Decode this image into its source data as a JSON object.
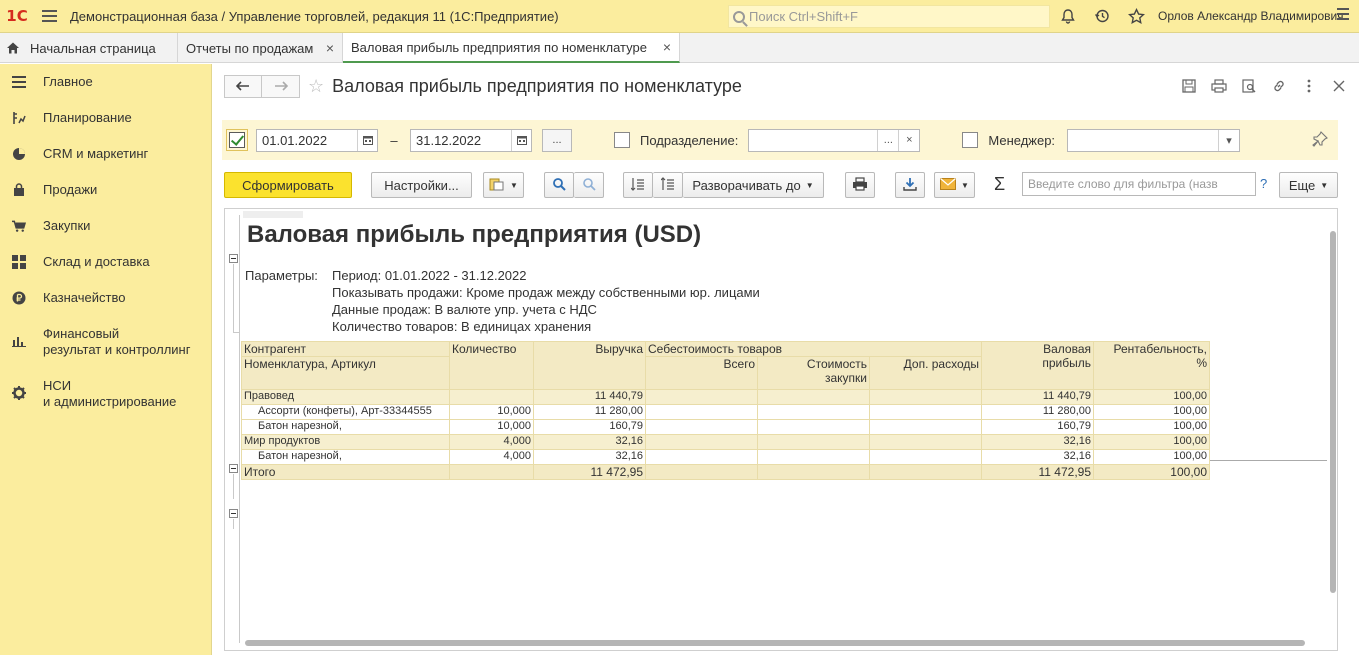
{
  "topbar": {
    "logo": "1С",
    "app_title": "Демонстрационная база / Управление торговлей, редакция 11  (1С:Предприятие)",
    "search_placeholder": "Поиск Ctrl+Shift+F",
    "user_name": "Орлов Александр Владимирович",
    "icons": [
      "bell-icon",
      "history-icon",
      "star-icon"
    ]
  },
  "tabs": [
    {
      "label": "Начальная страница"
    },
    {
      "label": "Отчеты по продажам"
    },
    {
      "label": "Валовая прибыль предприятия по номенклатуре"
    }
  ],
  "sidebar": {
    "items": [
      {
        "label": "Главное",
        "icon": "menu-list-icon"
      },
      {
        "label": "Планирование",
        "icon": "planning-icon"
      },
      {
        "label": "CRM и маркетинг",
        "icon": "pie-chart-icon"
      },
      {
        "label": "Продажи",
        "icon": "shopping-bag-icon"
      },
      {
        "label": "Закупки",
        "icon": "cart-icon"
      },
      {
        "label": "Склад и доставка",
        "icon": "warehouse-icon"
      },
      {
        "label": "Казначейство",
        "icon": "ruble-coin-icon"
      },
      {
        "label_line1": "Финансовый",
        "label_line2": "результат и контроллинг",
        "icon": "bar-chart-icon"
      },
      {
        "label_line1": "НСИ",
        "label_line2": "и администрирование",
        "icon": "gear-icon"
      }
    ]
  },
  "page": {
    "title": "Валовая прибыль предприятия по номенклатуре"
  },
  "params": {
    "period_enabled": true,
    "date_from": "01.01.2022",
    "date_sep": "–",
    "date_to": "31.12.2022",
    "dots": "...",
    "division_label": "Подразделение:",
    "manager_label": "Менеджер:"
  },
  "toolbar": {
    "generate": "Сформировать",
    "settings": "Настройки...",
    "expand_to": "Разворачивать до",
    "filter_placeholder": "Введите слово для фильтра (назв",
    "help": "?",
    "more": "Еще"
  },
  "report": {
    "title": "Валовая прибыль предприятия (USD)",
    "params_label": "Параметры:",
    "params_lines": [
      "Период: 01.01.2022 - 31.12.2022",
      "Показывать продажи: Кроме продаж между собственными юр. лицами",
      "Данные продаж: В валюте упр. учета с НДС",
      "Количество товаров: В единицах хранения"
    ],
    "headers": {
      "counterparty": "Контрагент",
      "item": "Номенклатура, Артикул",
      "qty": "Количество",
      "revenue": "Выручка",
      "cost_group": "Себестоимость товаров",
      "cost_total": "Всего",
      "purchase_cost_1": "Стоимость",
      "purchase_cost_2": "закупки",
      "extra_costs": "Доп. расходы",
      "gross_1": "Валовая",
      "gross_2": "прибыль",
      "margin_1": "Рентабельность,",
      "margin_2": "%"
    },
    "rows": [
      {
        "type": "group",
        "name": "Правовед",
        "qty": "",
        "revenue": "11 440,79",
        "gross": "11 440,79",
        "margin": "100,00"
      },
      {
        "type": "row",
        "name": "Ассорти (конфеты), Арт-33344555",
        "qty": "10,000",
        "revenue": "11 280,00",
        "gross": "11 280,00",
        "margin": "100,00"
      },
      {
        "type": "row",
        "name": "Батон нарезной,",
        "qty": "10,000",
        "revenue": "160,79",
        "gross": "160,79",
        "margin": "100,00"
      },
      {
        "type": "group",
        "name": "Мир продуктов",
        "qty": "4,000",
        "revenue": "32,16",
        "gross": "32,16",
        "margin": "100,00"
      },
      {
        "type": "row",
        "name": "Батон нарезной,",
        "qty": "4,000",
        "revenue": "32,16",
        "gross": "32,16",
        "margin": "100,00"
      }
    ],
    "total": {
      "name": "Итого",
      "revenue": "11 472,95",
      "gross": "11 472,95",
      "margin": "100,00"
    }
  }
}
